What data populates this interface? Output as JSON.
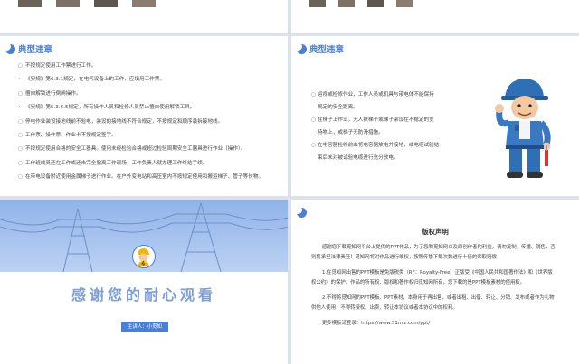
{
  "violations_left": {
    "title": "典型违章",
    "items": [
      {
        "mark": "▢",
        "text": "不按规定使用工作票进行工作。"
      },
      {
        "mark": "•",
        "text": "《安规》第6.3.1规定，在电气设备上的工作，应填用工作票。"
      },
      {
        "mark": "▢",
        "text": "擅自解锁进行倒闸操作。"
      },
      {
        "mark": "•",
        "text": "《安规》第5.3.6.5规定，所有操作人员和检修人员禁止擅自使用解锁工具。"
      },
      {
        "mark": "▢",
        "text": "停电作业装设接地线前不验电，装设的接地线不符合规定，不按规定和顺序装拆接地线。"
      },
      {
        "mark": "▢",
        "text": "工作票、操作票、作业卡不按规定签字。"
      },
      {
        "mark": "▢",
        "text": "不按规定使用合格的安全工器具。使用未经检验合格或超过检验周期安全工器具进行作业（操作）。"
      },
      {
        "mark": "▢",
        "text": "工作班成员还在工作或还未完全撤离工作现场，工作负责人就办理工作终结手续。"
      },
      {
        "mark": "▢",
        "text": "在带电设备附近使用金属梯子进行作业。在户外变电站和高压室内不按规定使用和搬运梯子、管子等长物。"
      }
    ]
  },
  "violations_right": {
    "title": "典型违章",
    "lines": [
      {
        "kind": "item",
        "mark": "▢",
        "text": "运视或检修作业，工作人员或机具与带电体不能保持"
      },
      {
        "kind": "cont",
        "text": "规定的安全距离。"
      },
      {
        "kind": "item",
        "mark": "▢",
        "text": "在梯子上作业，无人扶梯子或梯子架设在不稳定的支"
      },
      {
        "kind": "cont",
        "text": "持物上，或梯子无防滑措施。"
      },
      {
        "kind": "item",
        "mark": "▢",
        "text": "在电容器检修前未将电容器放电并接地，或电缆试验结"
      },
      {
        "kind": "cont",
        "text": "束后未对被试验电缆进行充分放电。"
      }
    ]
  },
  "thanks_slide": {
    "headline": "感谢您的耐心观看",
    "presenter": "主讲人：小觅知"
  },
  "copyright_slide": {
    "title": "版权声明",
    "paragraphs": [
      {
        "indent": true,
        "text": "感谢您下载觅知网平台上提供的PPT作品，为了您和觅知网以及原创作者的利益，请勿复制、传播、销售，否则将承担法律责任！觅知网将对作品进行维权，按照传播下载次数进行十倍的索取赔偿！"
      },
      {
        "indent": true,
        "text": "1.在觅知网出售的PPT模板是免版税类（RF：Royalty-Free）正版受《中国人民共和国著作法》和《世界版权公约》的保护，作品的所有权、版权和著作权归觅知网所有，您下载的是PPT模板素材的使用权。"
      },
      {
        "indent": true,
        "text": "2.不得将觅知网的PPT模板、PPT素材，本身用于再出售，或者出租、出借、转让、分销、发布或者作为礼物供他人使用，不得转授权、出卖、转让本协议或者本协议中的权利。"
      },
      {
        "indent": true,
        "text": "更多模板请登录：https://www.51miz.com/ppt/"
      }
    ]
  },
  "colors": {
    "accent": "#4a7fd6",
    "banner": "#8fb3ea"
  }
}
